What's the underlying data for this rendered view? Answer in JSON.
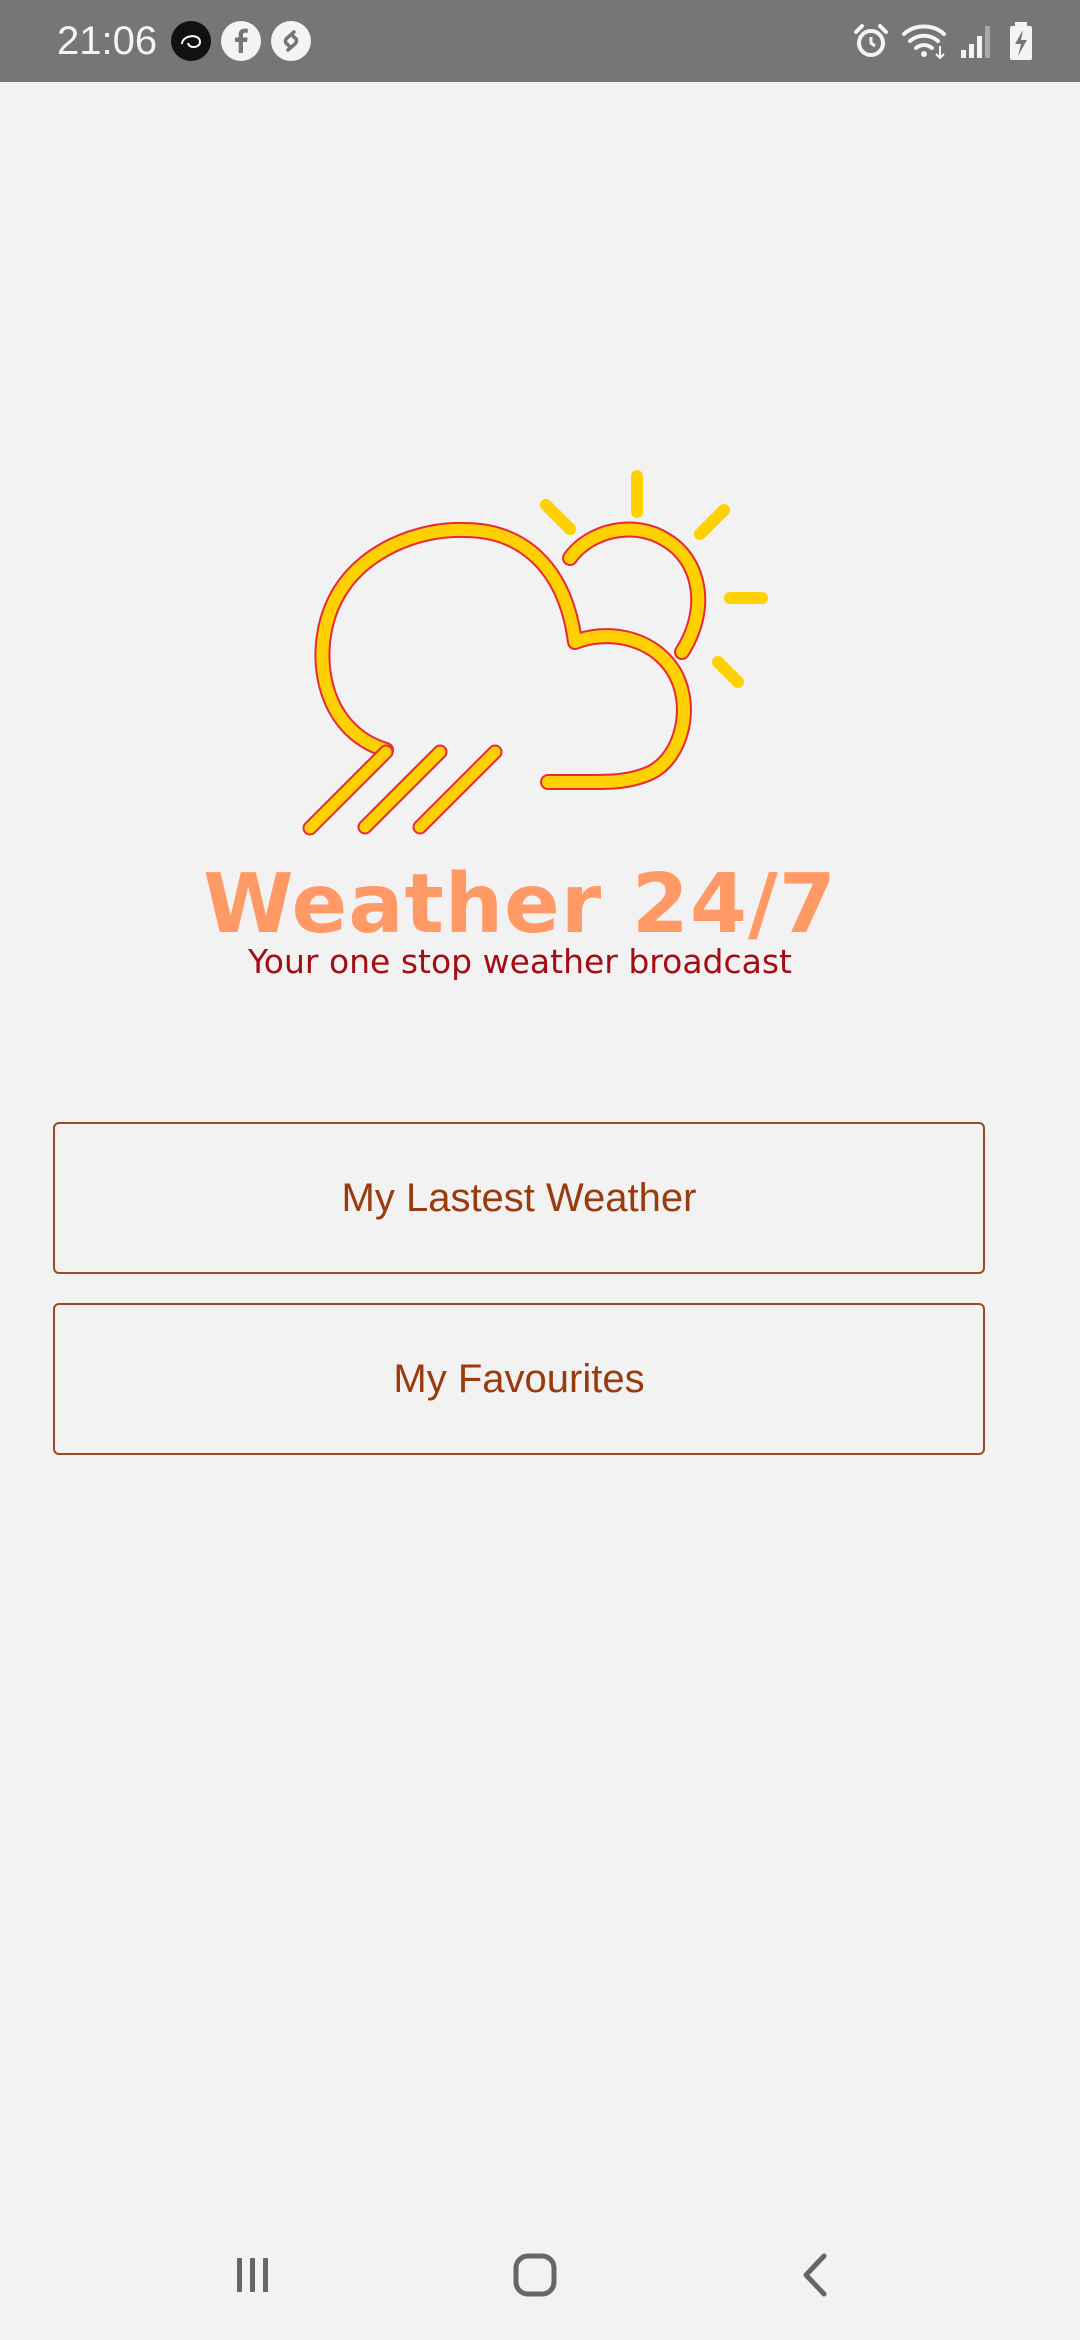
{
  "status_bar": {
    "time": "21:06",
    "left_icons": [
      "app-icon",
      "facebook-icon",
      "shazam-icon"
    ],
    "right_icons": [
      "alarm-icon",
      "wifi-icon",
      "signal-icon",
      "battery-icon"
    ]
  },
  "brand": {
    "title": "Weather 24/7",
    "tagline": "Your one stop weather broadcast",
    "logo_icon": "cloud-sun-rain-icon",
    "colors": {
      "title": "#ff9a67",
      "tagline": "#a40d14",
      "sun_cloud": "#ffd100",
      "outline": "#e8293a"
    }
  },
  "buttons": {
    "latest_label": "My Lastest Weather",
    "favourites_label": "My Favourites",
    "border_color": "#9a4b22",
    "text_color": "#9a3a0d"
  },
  "nav_bar": {
    "items": [
      "recent-apps-icon",
      "home-icon",
      "back-icon"
    ]
  }
}
